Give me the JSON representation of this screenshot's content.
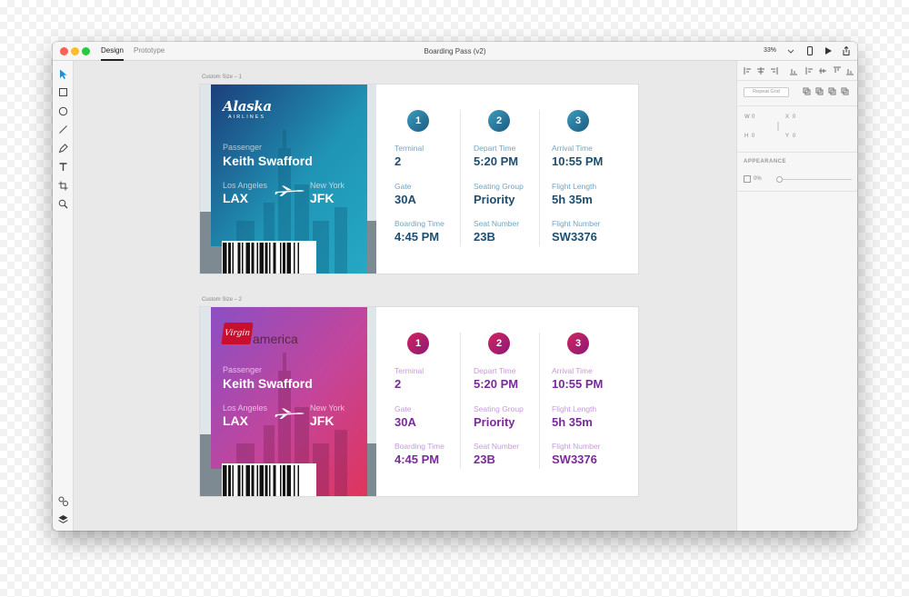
{
  "titlebar": {
    "tabs": [
      "Design",
      "Prototype"
    ],
    "document_title": "Boarding Pass (v2)",
    "zoom": "33%"
  },
  "toolbar": {
    "tools": [
      "select-tool-icon",
      "rectangle-tool-icon",
      "ellipse-tool-icon",
      "line-tool-icon",
      "pen-tool-icon",
      "text-tool-icon",
      "artboard-tool-icon",
      "zoom-tool-icon"
    ],
    "bottom": [
      "assets-icon",
      "layers-icon"
    ]
  },
  "artboards": [
    {
      "label": "Custom Size – 1",
      "brand": "alaska",
      "logo": {
        "name": "Alaska",
        "tagline": "AIRLINES"
      },
      "passenger_label": "Passenger",
      "passenger": "Keith Swafford",
      "from_city": "Los Angeles",
      "from_code": "LAX",
      "to_city": "New York",
      "to_code": "JFK",
      "accent": "#1e4e6f",
      "label_color": "#6fa5c5",
      "circle_colors": [
        "#3a9dbe",
        "#1d5a80"
      ],
      "gradient": [
        "#1b3f7a",
        "#2094b5",
        "#25a9c5"
      ],
      "steps": [
        {
          "num": "1",
          "fields": [
            {
              "label": "Terminal",
              "value": "2"
            },
            {
              "label": "Gate",
              "value": "30A"
            },
            {
              "label": "Boarding Time",
              "value": "4:45 PM"
            }
          ]
        },
        {
          "num": "2",
          "fields": [
            {
              "label": "Depart Time",
              "value": "5:20 PM"
            },
            {
              "label": "Seating Group",
              "value": "Priority"
            },
            {
              "label": "Seat Number",
              "value": "23B"
            }
          ]
        },
        {
          "num": "3",
          "fields": [
            {
              "label": "Arrival Time",
              "value": "10:55 PM"
            },
            {
              "label": "Flight Length",
              "value": "5h 35m"
            },
            {
              "label": "Flight Number",
              "value": "SW3376"
            }
          ]
        }
      ]
    },
    {
      "label": "Custom Size – 2",
      "brand": "virgin",
      "logo": {
        "name": "Virgin",
        "tagline": "america"
      },
      "passenger_label": "Passenger",
      "passenger": "Keith Swafford",
      "from_city": "Los Angeles",
      "from_code": "LAX",
      "to_city": "New York",
      "to_code": "JFK",
      "accent": "#7a2a9a",
      "label_color": "#c79ad9",
      "circle_colors": [
        "#d3245e",
        "#8a1a78"
      ],
      "gradient": [
        "#8b4fc4",
        "#c4459a",
        "#e0345b"
      ],
      "steps": [
        {
          "num": "1",
          "fields": [
            {
              "label": "Terminal",
              "value": "2"
            },
            {
              "label": "Gate",
              "value": "30A"
            },
            {
              "label": "Boarding Time",
              "value": "4:45 PM"
            }
          ]
        },
        {
          "num": "2",
          "fields": [
            {
              "label": "Depart Time",
              "value": "5:20 PM"
            },
            {
              "label": "Seating Group",
              "value": "Priority"
            },
            {
              "label": "Seat Number",
              "value": "23B"
            }
          ]
        },
        {
          "num": "3",
          "fields": [
            {
              "label": "Arrival Time",
              "value": "10:55 PM"
            },
            {
              "label": "Flight Length",
              "value": "5h 35m"
            },
            {
              "label": "Flight Number",
              "value": "SW3376"
            }
          ]
        }
      ]
    }
  ],
  "inspector": {
    "repeat_grid": "Repeat Grid",
    "w_label": "W",
    "w_value": "0",
    "x_label": "X",
    "x_value": "0",
    "h_label": "H",
    "h_value": "0",
    "y_label": "Y",
    "y_value": "0",
    "appearance": "APPEARANCE",
    "opacity": "0%"
  }
}
